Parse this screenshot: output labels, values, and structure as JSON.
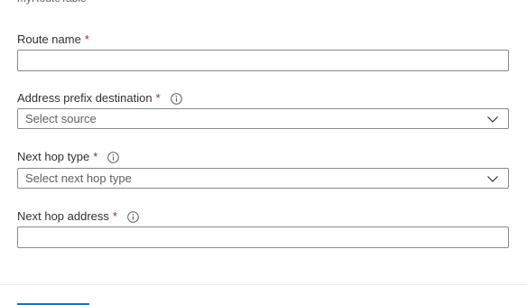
{
  "header": {
    "subtitle": "myRouteTable"
  },
  "form": {
    "route_name": {
      "label": "Route name",
      "required_mark": "*",
      "value": "",
      "placeholder": ""
    },
    "address_prefix_destination": {
      "label": "Address prefix destination",
      "required_mark": "*",
      "info_icon": "info-icon",
      "selected_value": "Select source"
    },
    "next_hop_type": {
      "label": "Next hop type",
      "required_mark": "*",
      "info_icon": "info-icon",
      "selected_value": "Select next hop type"
    },
    "next_hop_address": {
      "label": "Next hop address",
      "required_mark": "*",
      "info_icon": "info-icon",
      "value": "",
      "placeholder": ""
    }
  },
  "colors": {
    "required": "#a4262c",
    "border": "#8a8886",
    "accent": "#0078d4"
  }
}
